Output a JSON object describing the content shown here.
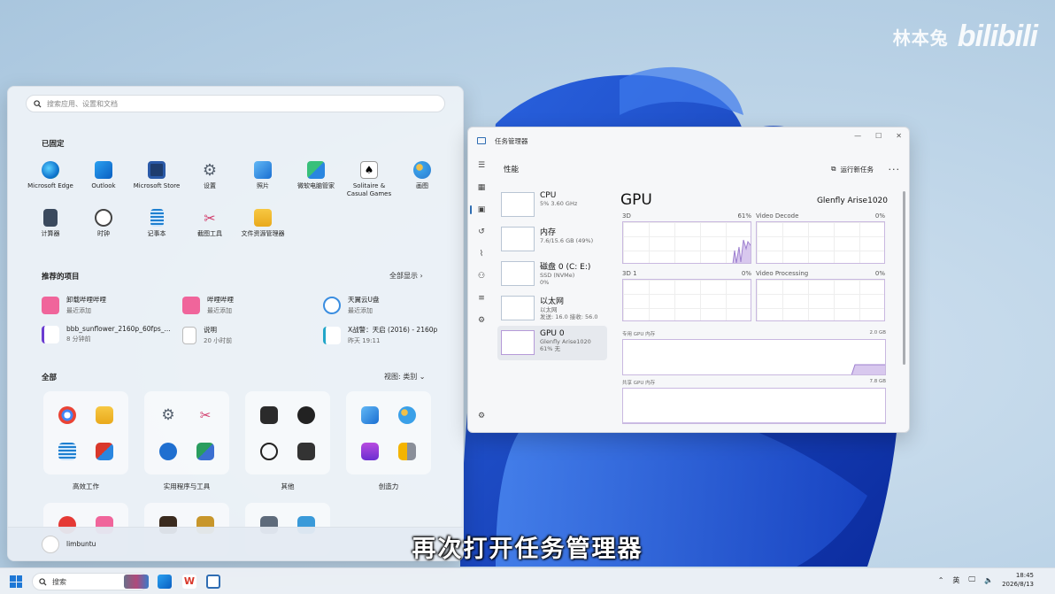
{
  "watermark": {
    "name": "林本兔",
    "logo": "bilibili"
  },
  "start_menu": {
    "search_placeholder": "搜索应用、设置和文档",
    "pinned_title": "已固定",
    "pinned": [
      {
        "label": "Microsoft Edge",
        "icon": "edge-icon"
      },
      {
        "label": "Outlook",
        "icon": "outlook-icon"
      },
      {
        "label": "Microsoft Store",
        "icon": "store-icon"
      },
      {
        "label": "设置",
        "icon": "settings-icon"
      },
      {
        "label": "照片",
        "icon": "photos-icon"
      },
      {
        "label": "微软电脑管家",
        "icon": "pc-manager-icon"
      },
      {
        "label": "Solitaire & Casual Games",
        "icon": "solitaire-icon"
      },
      {
        "label": "画图",
        "icon": "paint-icon"
      },
      {
        "label": "计算器",
        "icon": "calculator-icon"
      },
      {
        "label": "时钟",
        "icon": "clock-icon"
      },
      {
        "label": "记事本",
        "icon": "notepad-icon"
      },
      {
        "label": "截图工具",
        "icon": "snipping-tool-icon"
      },
      {
        "label": "文件资源管理器",
        "icon": "file-explorer-icon"
      }
    ],
    "recommended_title": "推荐的项目",
    "show_all": "全部显示",
    "recommended": [
      {
        "title": "卸载哔哩哔哩",
        "sub": "最近添加"
      },
      {
        "title": "哔哩哔哩",
        "sub": "最近添加"
      },
      {
        "title": "天翼云U盘",
        "sub": "最近添加"
      },
      {
        "title": "bbb_sunflower_2160p_60fps_...",
        "sub": "8 分钟前"
      },
      {
        "title": "说明",
        "sub": "20 小时前"
      },
      {
        "title": "X战警：天启 (2016) - 2160p",
        "sub": "昨天 19:11"
      }
    ],
    "all_title": "全部",
    "view_label": "视图: 类别",
    "categories": [
      "高效工作",
      "实用程序与工具",
      "其他",
      "创造力"
    ],
    "user": "limbuntu"
  },
  "task_manager": {
    "window_title": "任务管理器",
    "controls": [
      "—",
      "☐",
      "✕"
    ],
    "section": "性能",
    "run_new_task": "运行新任务",
    "more": "···",
    "resources": [
      {
        "name": "CPU",
        "sub1": "5% 3.60 GHz",
        "sub2": ""
      },
      {
        "name": "内存",
        "sub1": "7.6/15.6 GB (49%)",
        "sub2": ""
      },
      {
        "name": "磁盘 0 (C: E:)",
        "sub1": "SSD (NVMe)",
        "sub2": "0%"
      },
      {
        "name": "以太网",
        "sub1": "以太网",
        "sub2": "发送: 16.0 接收: 56.0"
      },
      {
        "name": "GPU 0",
        "sub1": "Glenfly Arise1020",
        "sub2": "61% 无"
      }
    ],
    "gpu_title": "GPU",
    "gpu_model": "Glenfly Arise1020",
    "engines": [
      {
        "name": "3D",
        "value": "61%"
      },
      {
        "name": "Video Decode",
        "value": "0%"
      },
      {
        "name": "3D 1",
        "value": "0%"
      },
      {
        "name": "Video Processing",
        "value": "0%"
      }
    ],
    "dedicated_label": "专用 GPU 内存",
    "dedicated_value": "2.0 GB",
    "shared_label": "共享 GPU 内存",
    "shared_value": "7.8 GB"
  },
  "subtitle": "再次打开任务管理器",
  "taskbar": {
    "search_placeholder": "搜索",
    "ime": "英",
    "time": "18:45",
    "date": "2026/8/13"
  },
  "colors": {
    "accent": "#2f6db3",
    "graph": "#b59ad8"
  }
}
